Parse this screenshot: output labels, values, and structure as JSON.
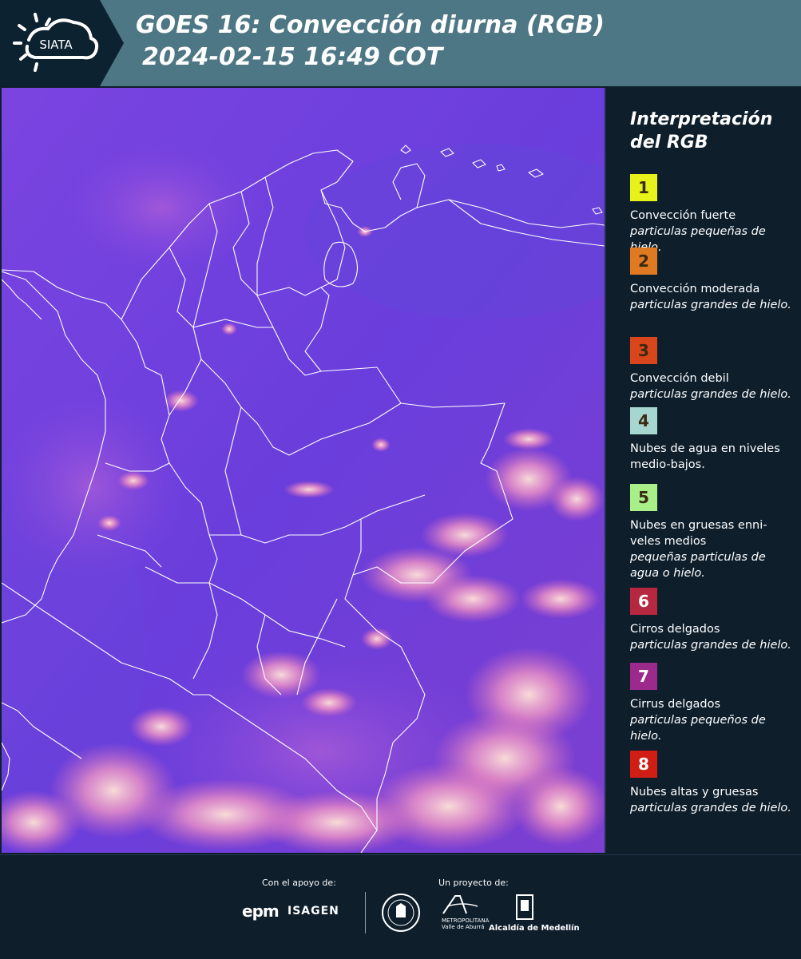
{
  "header": {
    "logo_text": "SIATA",
    "title_line1": "GOES 16: Convección diurna (RGB)",
    "title_line2": "2024-02-15 16:49 COT"
  },
  "legend": {
    "title": "Interpretación del RGB",
    "items": [
      {
        "number": "1",
        "color": "#e6f21a",
        "label": "Convección fuerte",
        "sub": "particulas pequeñas de hielo."
      },
      {
        "number": "2",
        "color": "#e07a22",
        "label": "Convección moderada",
        "sub": "particulas grandes de hielo."
      },
      {
        "number": "3",
        "color": "#d9461c",
        "label": "Convección debil",
        "sub": "particulas grandes de hielo."
      },
      {
        "number": "4",
        "color": "#a6d6cf",
        "label": "Nubes de agua en niveles medio-bajos.",
        "sub": ""
      },
      {
        "number": "5",
        "color": "#a8ef8a",
        "label": "Nubes en gruesas enni-veles medios",
        "sub": "pequeñas particulas de agua o hielo."
      },
      {
        "number": "6",
        "color": "#b6283f",
        "label": "Cirros delgados",
        "sub": "particulas grandes de hielo."
      },
      {
        "number": "7",
        "color": "#9c2a8c",
        "label": "Cirrus delgados",
        "sub": "particulas pequeños de hielo."
      },
      {
        "number": "8",
        "color": "#d01e14",
        "label": "Nubes altas y gruesas",
        "sub": "particulas grandes de hielo."
      }
    ]
  },
  "footer": {
    "support_label": "Con el apoyo de:",
    "project_label": "Un proyecto de:",
    "sponsor1": "epm",
    "sponsor2": "ISAGEN",
    "partner_area_line1": "METROPOLITANA",
    "partner_area_line2": "Valle de Aburrá",
    "partner_alcaldia": "Alcaldía de Medellín"
  },
  "map": {
    "base_color": "#6f3fe0",
    "cloud_color": "#f7a0c8",
    "border_color": "#ffffff"
  }
}
